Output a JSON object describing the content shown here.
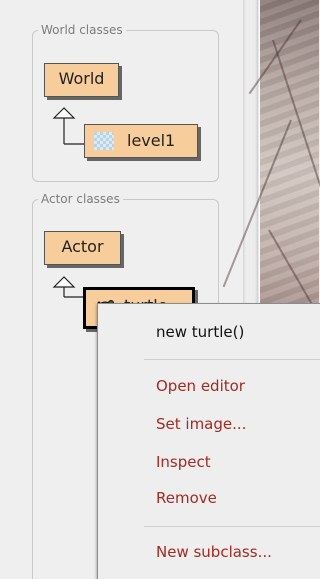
{
  "world_classes": {
    "legend": "World classes",
    "parent": "World",
    "child": "level1"
  },
  "actor_classes": {
    "legend": "Actor classes",
    "parent": "Actor",
    "child": "turtle"
  },
  "context_menu": {
    "constructor": "new turtle()",
    "items": [
      "Open editor",
      "Set image...",
      "Inspect",
      "Remove"
    ],
    "subclass": "New subclass..."
  },
  "colors": {
    "class_box": "#f6cd9b",
    "menu_red": "#a52a21"
  }
}
